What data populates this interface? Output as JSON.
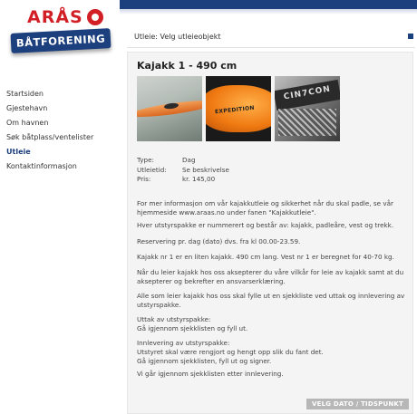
{
  "logo": {
    "top": "ARÅS",
    "banner": "BÅTFORENING"
  },
  "nav": {
    "items": [
      {
        "label": "Startsiden"
      },
      {
        "label": "Gjestehavn"
      },
      {
        "label": "Om havnen"
      },
      {
        "label": "Søk båtplass/ventelister"
      },
      {
        "label": "Utleie"
      },
      {
        "label": "Kontaktinformasjon"
      }
    ],
    "active": "Utleie"
  },
  "breadcrumb": "Utleie: Velg utleieobjekt",
  "item": {
    "title": "Kajakk 1 - 490 cm",
    "photo2_brand": "EXPEDITION",
    "photo3_brand": "CIN7CON",
    "details": [
      {
        "label": "Type:",
        "value": "Dag"
      },
      {
        "label": "Utleietid:",
        "value": "Se beskrivelse"
      },
      {
        "label": "Pris:",
        "value": "kr. 145,00"
      }
    ],
    "paragraphs": [
      "For mer informasjon om vår kajakkutleie og sikkerhet når du skal padle, se vår hjemmeside www.araas.no under fanen \"Kajakkutleie\".",
      "Hver utstyrspakke er nummerert og består av: kajakk, padleåre, vest og trekk.",
      "Reservering pr. dag (dato) dvs. fra kl 00.00-23.59.",
      "Kajakk nr 1 er en liten kajakk. 490 cm lang. Vest nr 1 er beregnet for 40-70 kg.",
      "Når du leier kajakk hos oss aksepterer du våre vilkår for leie av kajakk samt at du aksepterer og bekrefter en ansvarserklæring.",
      "Alle som leier kajakk hos oss skal fylle ut en sjekkliste ved uttak og innlevering av utstyrspakke.",
      "Uttak av utstyrspakke:\nGå igjennom sjekklisten og fyll ut.",
      "Innlevering av utstyrspakke:\nUtstyret skal være rengjort og hengt opp slik du fant det.\nGå igjennom sjekklisten, fyll ut og signer.",
      "Vi går igjennom sjekklisten etter innlevering."
    ]
  },
  "cta_label": "VELG DATO / TIDSPUNKT",
  "colors": {
    "brand_blue": "#1c3f7d",
    "brand_red": "#d21f26",
    "button_grey": "#b7b7b7"
  }
}
